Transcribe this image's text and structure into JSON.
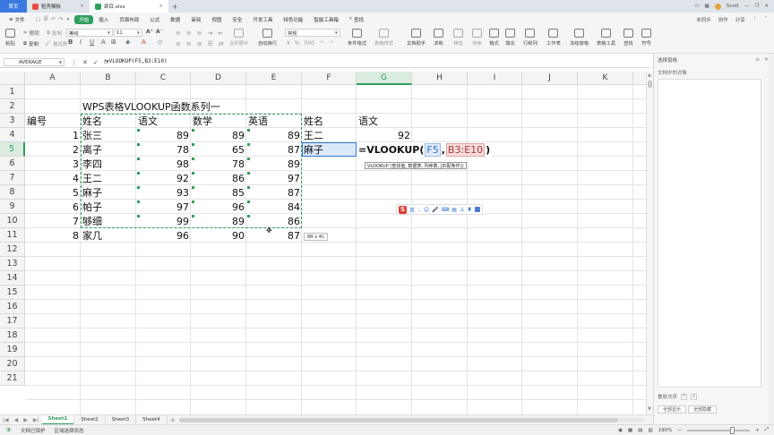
{
  "titlebar": {
    "home_tab": "首页",
    "tab_template": "稻壳模板",
    "tab_doc": "部目.xlsx",
    "user": "Scott",
    "colors": {
      "home_tab": "#3a7ae0",
      "accent_green": "#2f9d5c"
    }
  },
  "menubar": {
    "items": [
      "文件",
      "开始",
      "插入",
      "页面布局",
      "公式",
      "数据",
      "审阅",
      "视图",
      "安全",
      "开发工具",
      "特色功能",
      "智能工具箱"
    ],
    "search": "查找",
    "right": [
      "未同步",
      "协作",
      "分享"
    ]
  },
  "ribbon": {
    "paste": "粘贴",
    "cut": "剪切",
    "copy": "复制",
    "format_painter": "格式刷",
    "font_name": "等线",
    "font_size": "11",
    "merge_center": "合并居中",
    "wrap_text": "自动换行",
    "number_format": "常规",
    "cond_format": "条件格式",
    "table_style": "表格样式",
    "doc_assist": "文档助手",
    "sum": "求和",
    "filter": "筛选",
    "sort": "排序",
    "format": "格式",
    "fill": "填充",
    "row_col": "行和列",
    "worksheet": "工作表",
    "freeze": "冻结窗格",
    "table_tools": "表格工具",
    "find": "查找",
    "symbol": "符号"
  },
  "formulabar": {
    "namebox": "AVERAGE",
    "formula": "=VLOOKUP(F5,B3:E10)"
  },
  "sheet": {
    "columns": [
      "A",
      "B",
      "C",
      "D",
      "E",
      "F",
      "G",
      "H",
      "I",
      "J",
      "K"
    ],
    "rows": [
      "1",
      "2",
      "3",
      "4",
      "5",
      "6",
      "7",
      "8",
      "9",
      "10",
      "11",
      "12",
      "13",
      "14",
      "15",
      "16",
      "17",
      "18",
      "19",
      "20",
      "21"
    ],
    "title": "WPS表格VLOOKUP函数系列一",
    "headers": {
      "a": "编号",
      "b": "姓名",
      "c": "语文",
      "d": "数学",
      "e": "英语"
    },
    "records": [
      {
        "id": "1",
        "name": "张三",
        "chinese": "89",
        "math": "89",
        "english": "89"
      },
      {
        "id": "2",
        "name": "离子",
        "chinese": "78",
        "math": "65",
        "english": "87"
      },
      {
        "id": "3",
        "name": "李四",
        "chinese": "98",
        "math": "78",
        "english": "89"
      },
      {
        "id": "4",
        "name": "王二",
        "chinese": "92",
        "math": "86",
        "english": "97"
      },
      {
        "id": "5",
        "name": "麻子",
        "chinese": "93",
        "math": "85",
        "english": "87"
      },
      {
        "id": "6",
        "name": "帕子",
        "chinese": "97",
        "math": "96",
        "english": "84"
      },
      {
        "id": "7",
        "name": "够细",
        "chinese": "99",
        "math": "89",
        "english": "86"
      },
      {
        "id": "8",
        "name": "家几",
        "chinese": "96",
        "math": "90",
        "english": "87"
      }
    ],
    "lookup": {
      "header_name": "姓名",
      "header_score": "语文",
      "name1": "王二",
      "score1": "92",
      "name2": "麻子"
    },
    "edit": {
      "prefix": "=VLOOKUP(",
      "ref1": "F5",
      "sep": ",",
      "ref2": "B3:E10",
      "suffix": ")"
    },
    "tooltip": "VLOOKUP (查找值, 数据表, 列序数, [匹配条件])",
    "size_tip": "8R x 4C",
    "ime_label": "英"
  },
  "sheettabs": {
    "tabs": [
      "Sheet1",
      "Sheet2",
      "Sheet3",
      "Sheet4"
    ],
    "active": "Sheet1"
  },
  "statusbar": {
    "doc_status": "文档已保护",
    "mode": "区域选择状态",
    "zoom": "190%"
  },
  "panel": {
    "title": "选择窗格",
    "subtitle": "文档中的对象",
    "order_label": "叠放次序",
    "show_all": "全部显示",
    "hide_all": "全部隐藏"
  }
}
